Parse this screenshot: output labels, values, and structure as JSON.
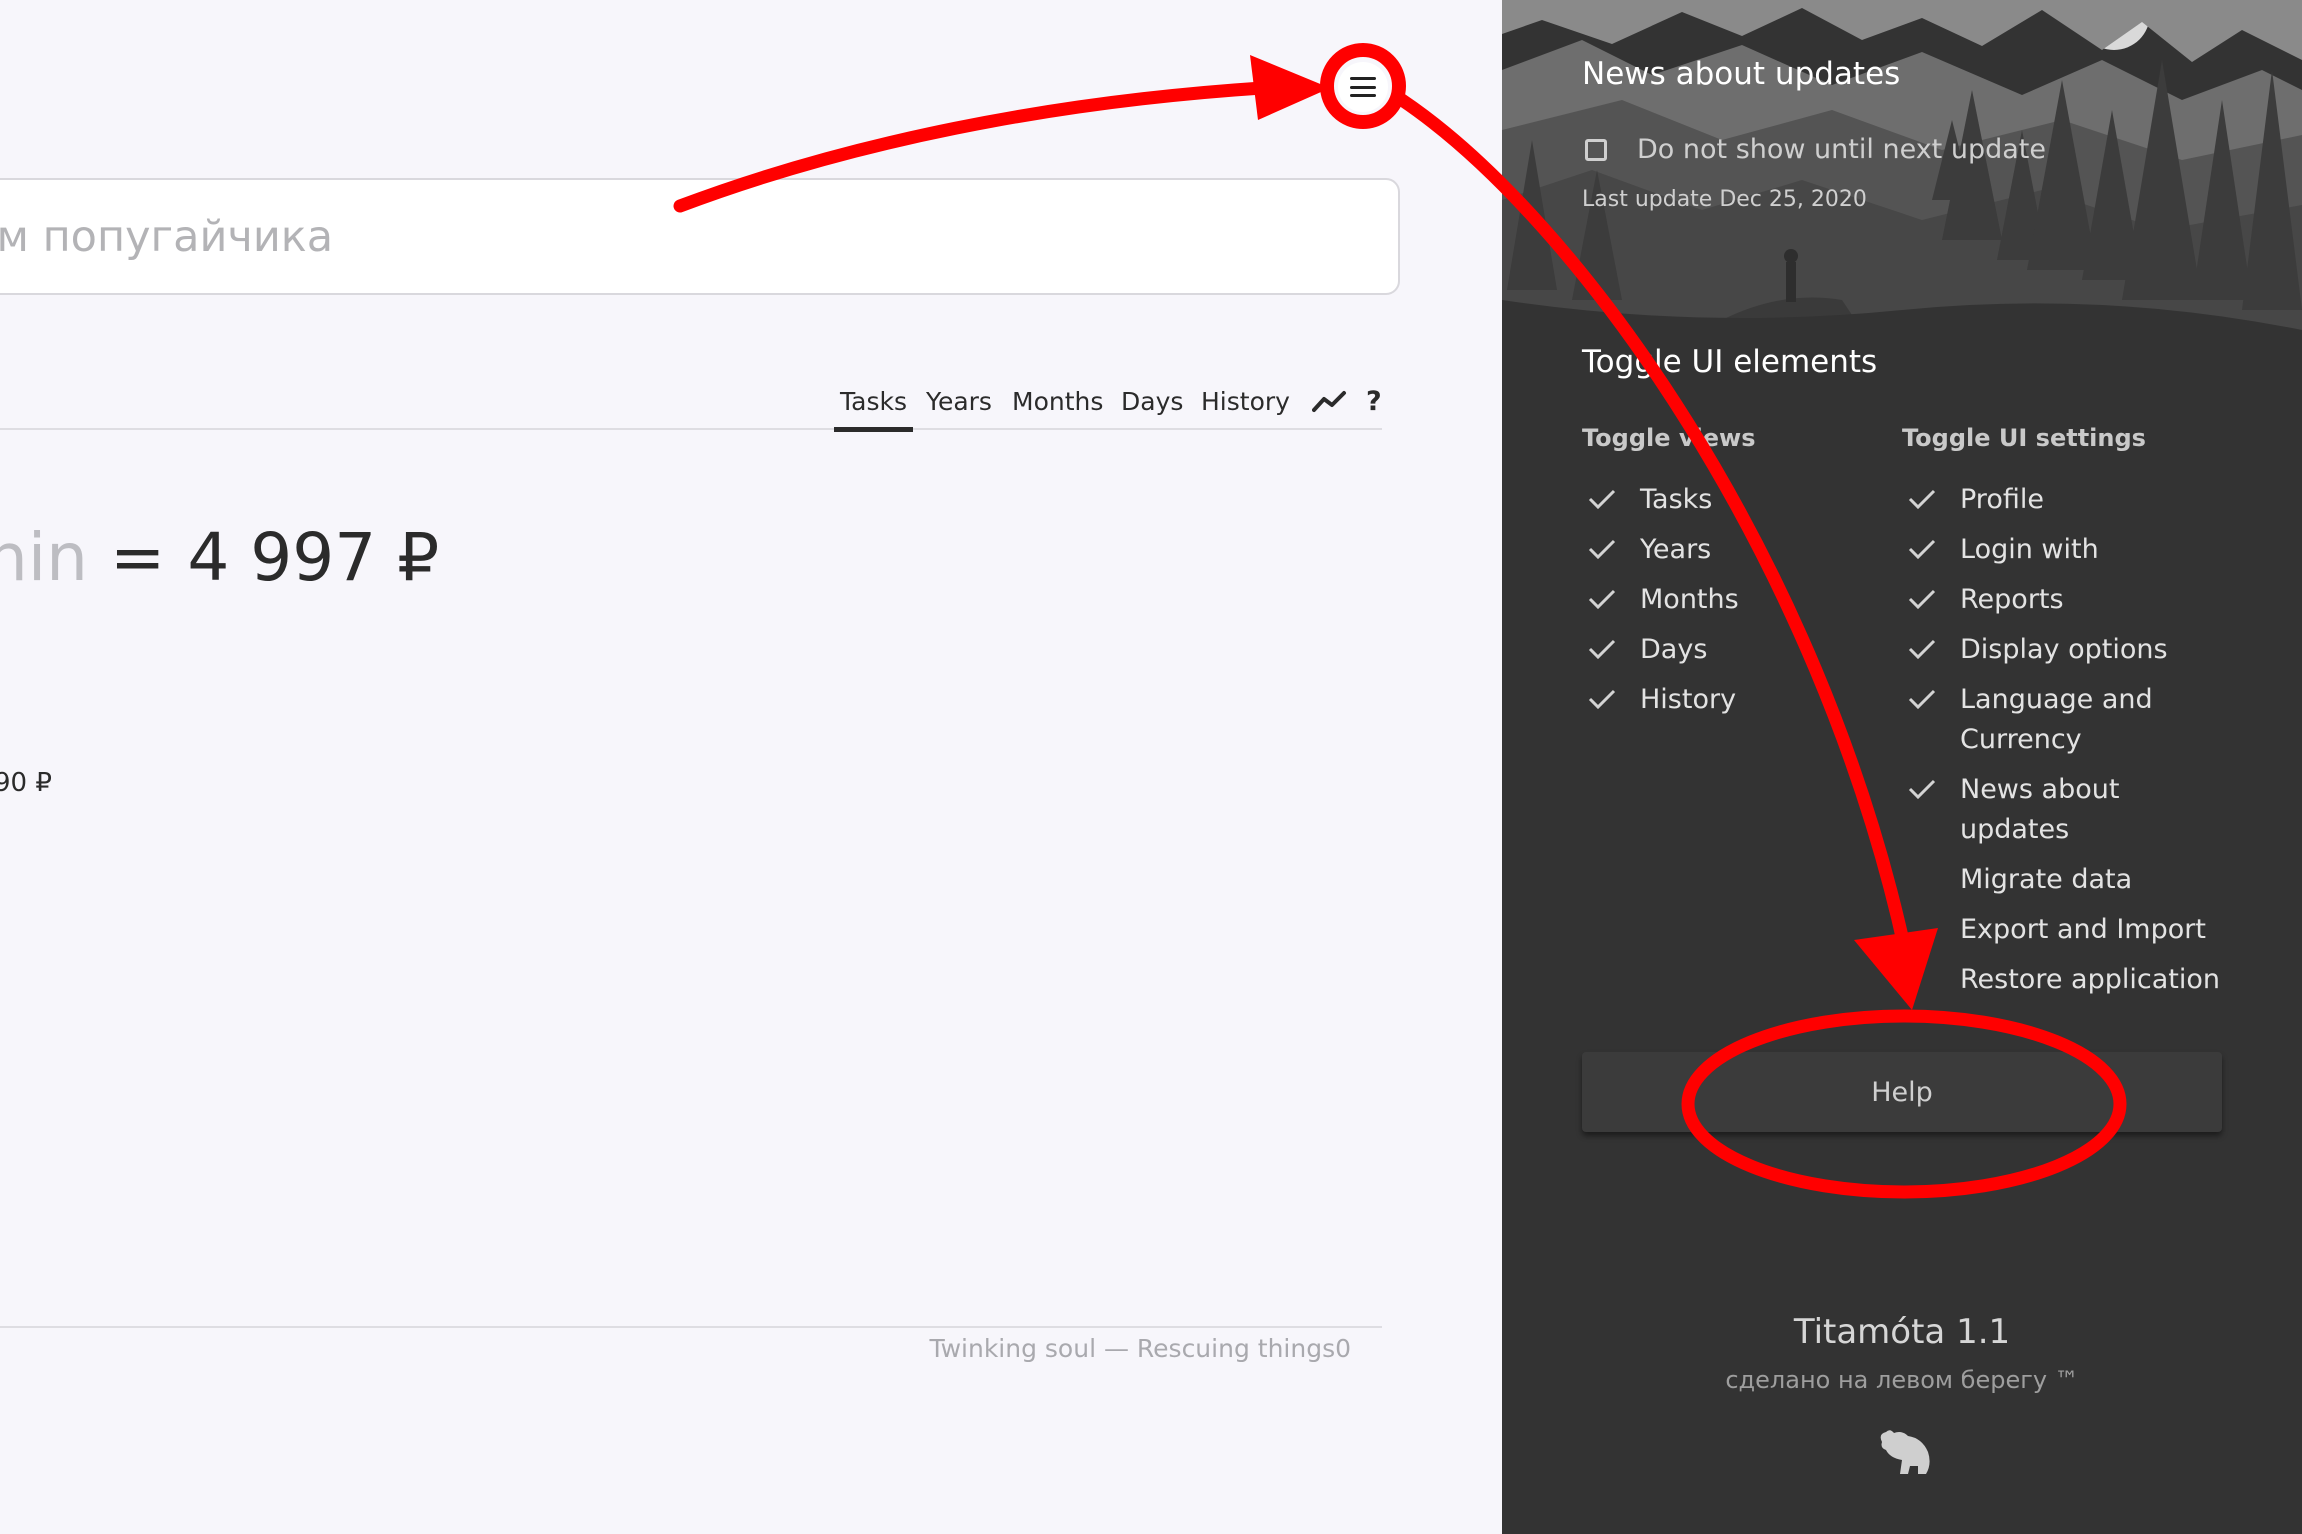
{
  "main": {
    "search": {
      "placeholder": "ем попугайчика"
    },
    "tabs": [
      {
        "label": "Tasks",
        "active": true
      },
      {
        "label": "Years",
        "active": false
      },
      {
        "label": "Months",
        "active": false
      },
      {
        "label": "Days",
        "active": false
      },
      {
        "label": "History",
        "active": false
      }
    ],
    "trend_icon": "trend-line-icon",
    "help_symbol": "?",
    "result": {
      "unit": "hin",
      "equals": "=",
      "amount": "4 997 ₽"
    },
    "secondary_amount": "90 ₽",
    "footer_text": "Twinking soul — Rescuing things0"
  },
  "panel": {
    "news": {
      "heading": "News about updates",
      "checkbox_label": "Do not show until next update",
      "checkbox_checked": false,
      "last_update": "Last update Dec 25, 2020"
    },
    "toggle_ui": {
      "heading": "Toggle UI elements",
      "views_title": "Toggle views",
      "settings_title": "Toggle UI settings",
      "views": [
        {
          "label": "Tasks",
          "checked": true
        },
        {
          "label": "Years",
          "checked": true
        },
        {
          "label": "Months",
          "checked": true
        },
        {
          "label": "Days",
          "checked": true
        },
        {
          "label": "History",
          "checked": true
        }
      ],
      "settings": [
        {
          "label": "Profile",
          "checked": true
        },
        {
          "label": "Login with",
          "checked": true
        },
        {
          "label": "Reports",
          "checked": true
        },
        {
          "label": "Display options",
          "checked": true
        },
        {
          "label": "Language and Currency",
          "checked": true
        },
        {
          "label": "News about updates",
          "checked": true
        },
        {
          "label": "Migrate data",
          "checked": false
        },
        {
          "label": "Export and Import",
          "checked": false
        },
        {
          "label": "Restore application",
          "checked": false
        }
      ]
    },
    "help_button": "Help",
    "app_version": "Titamóta 1.1",
    "app_credit": "сделано на левом берегу ™",
    "logo_icon": "bear-icon"
  },
  "colors": {
    "page_background": "#f7f6fb",
    "panel_background": "#333333",
    "annotation_red": "#ff0000",
    "text_dark": "#2b2b2b"
  }
}
